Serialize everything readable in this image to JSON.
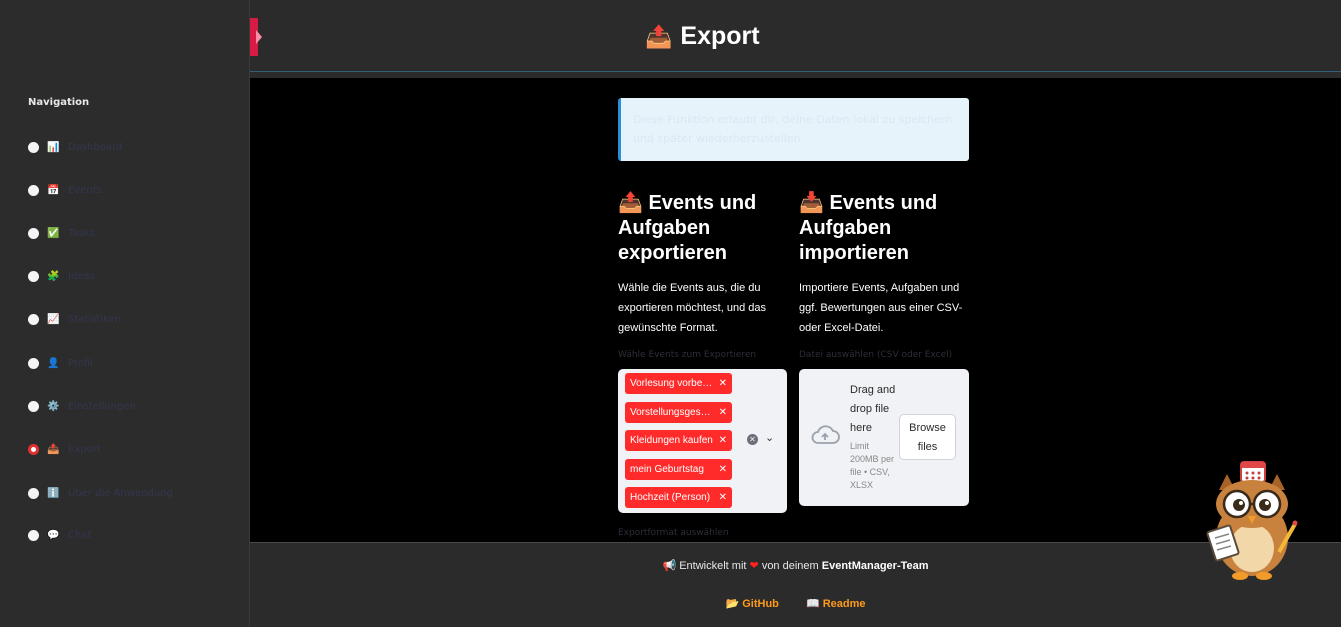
{
  "sidebar": {
    "title": "Navigation",
    "items": [
      {
        "icon": "📊",
        "label": "Dashboard",
        "selected": false
      },
      {
        "icon": "📅",
        "label": "Events",
        "selected": false
      },
      {
        "icon": "✅",
        "label": "Tasks",
        "selected": false
      },
      {
        "icon": "🧩",
        "label": "Ideas",
        "selected": false
      },
      {
        "icon": "📈",
        "label": "Statistiken",
        "selected": false
      },
      {
        "icon": "👤",
        "label": "Profil",
        "selected": false
      },
      {
        "icon": "⚙️",
        "label": "Einstellungen",
        "selected": false
      },
      {
        "icon": "📤",
        "label": "Export",
        "selected": true
      },
      {
        "icon": "ℹ️",
        "label": "Über die Anwendung",
        "selected": false
      },
      {
        "icon": "💬",
        "label": "Chat",
        "selected": false
      }
    ]
  },
  "header": {
    "title": "Export",
    "icon": "📤"
  },
  "main": {
    "info": "Diese Funktion erlaubt dir, deine Daten lokal zu speichern und später wiederherzustellen.",
    "export": {
      "icon": "📤",
      "title": "Events und Aufgaben exportieren",
      "desc": "Wähle die Events aus, die du exportieren möchtest, und das gewünschte Format.",
      "select_label": "Wähle Events zum Exportieren",
      "tags": [
        "Vorlesung vorbereiten",
        "Vorstellungsgespräch",
        "Kleidungen kaufen",
        "mein Geburtstag",
        "Hochzeit (Person)"
      ],
      "format_label": "Exportformat auswählen"
    },
    "import": {
      "icon": "📥",
      "title": "Events und Aufgaben importieren",
      "desc": "Importiere Events, Aufgaben und ggf. Bewertungen aus einer CSV- oder Excel-Datei.",
      "upload_label": "Datei auswählen (CSV oder Excel)",
      "drop_text": "Drag and drop file here",
      "limit_text": "Limit 200MB per file • CSV, XLSX",
      "browse_label": "Browse files"
    }
  },
  "footer": {
    "prefix_icon": "📢",
    "text_before": "Entwickelt mit",
    "text_after": "von deinem",
    "team": "EventManager-Team",
    "links": [
      {
        "icon": "📂",
        "label": "GitHub"
      },
      {
        "icon": "📖",
        "label": "Readme"
      }
    ]
  },
  "colors": {
    "accent": "#ff2b2b",
    "link": "#ff9a1a",
    "info_border": "#2a8fd6"
  }
}
